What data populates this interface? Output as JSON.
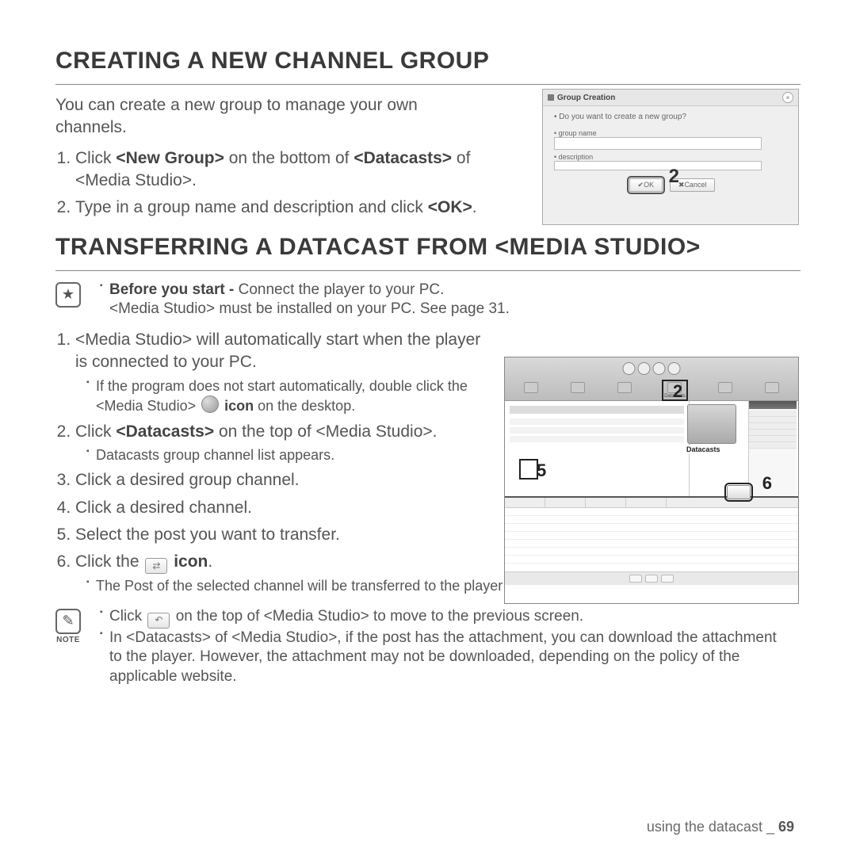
{
  "section1": {
    "heading": "CREATING A NEW CHANNEL GROUP",
    "intro": "You can create a new group to manage your own channels.",
    "step1a": "Click ",
    "step1b": "<New Group>",
    "step1c": " on the bottom of ",
    "step1d": "<Datacasts>",
    "step1e": " of <Media Studio>.",
    "step2a": "Type in a group name and description and click ",
    "step2b": "<OK>",
    "step2c": "."
  },
  "dialog": {
    "title": "Group Creation",
    "question": "Do you want to create a new group?",
    "groupname_label": "group name",
    "description_label": "description",
    "ok_label": "OK",
    "cancel_label": "Cancel",
    "callout": "2"
  },
  "section2": {
    "heading": "TRANSFERRING A DATACAST FROM <MEDIA STUDIO>",
    "before_bold": "Before you start - ",
    "before_rest": "Connect the player to your PC.",
    "before_line2": "<Media Studio> must be installed on your PC. See page 31.",
    "s1": "<Media Studio> will automatically start when the player is connected to your PC.",
    "s1_sub_a": "If the program does not start automatically, double click the <Media Studio> ",
    "s1_sub_b": " icon",
    "s1_sub_c": " on the desktop.",
    "s2a": "Click ",
    "s2b": "<Datacasts>",
    "s2c": " on the top of <Media Studio>.",
    "s2_sub": "Datacasts group channel list appears.",
    "s3": "Click a desired group channel.",
    "s4": "Click a desired channel.",
    "s5": "Select the post you want to transfer.",
    "s6a": "Click the ",
    "s6b": " icon",
    "s6c": ".",
    "s6_sub": "The Post of the selected channel will be transferred to the player in <File Browser> → <Datacasts>.",
    "note1a": "Click ",
    "note1b": " on the top of <Media Studio> to move to the previous screen.",
    "note2": "In <Datacasts> of <Media Studio>, if the post has the attachment, you can download the attachment to the player. However, the attachment may not be downloaded, depending on the policy of the applicable website.",
    "note_label": "NOTE"
  },
  "app": {
    "datacasts_label": "Datacasts",
    "callout2": "2",
    "callout5": "5",
    "callout6": "6"
  },
  "footer": {
    "text": "using the datacast _ ",
    "page": "69"
  }
}
